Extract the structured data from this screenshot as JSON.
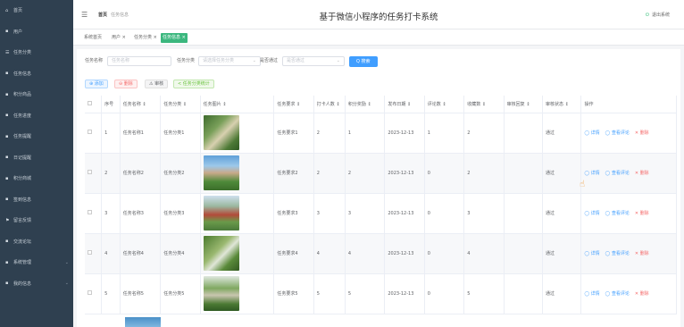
{
  "sidebar": {
    "items": [
      {
        "icon": "⌂",
        "label": "首页"
      },
      {
        "icon": "▪",
        "label": "用户"
      },
      {
        "icon": "☰",
        "label": "任务分类"
      },
      {
        "icon": "▪",
        "label": "任务信息"
      },
      {
        "icon": "▪",
        "label": "积分商品"
      },
      {
        "icon": "▪",
        "label": "任务进度"
      },
      {
        "icon": "▪",
        "label": "任务提醒"
      },
      {
        "icon": "▪",
        "label": "日记提醒"
      },
      {
        "icon": "▪",
        "label": "积分商城"
      },
      {
        "icon": "▪",
        "label": "签到信息"
      },
      {
        "icon": "⚑",
        "label": "留言反馈"
      },
      {
        "icon": "▪",
        "label": "交流论坛"
      },
      {
        "icon": "▪",
        "label": "系统管理",
        "arrow": "⌄"
      },
      {
        "icon": "▪",
        "label": "我的信息",
        "arrow": "⌄"
      }
    ]
  },
  "header": {
    "menu_icon": "☰",
    "crumb_home": "首页",
    "crumb_current": "任务信息",
    "title": "基于微信小程序的任务打卡系统",
    "logout": "退出系统",
    "logout_icon": "⏻"
  },
  "tabs": [
    "系统首页",
    "用户 ×",
    "任务分类 ×",
    "任务信息 ×"
  ],
  "filters": {
    "name_label": "任务名称",
    "name_placeholder": "任务名称",
    "category_label": "任务分类",
    "category_placeholder": "请选择任务分类",
    "audit_label": "是否通过",
    "audit_placeholder": "是否通过",
    "search_button": "Q 搜索"
  },
  "toolbar": {
    "add": "⊕ 添加",
    "delete": "⊖ 删除",
    "audit": "⚠ 审核",
    "stat": "< 任务分类统计"
  },
  "table": {
    "headers": [
      "",
      "序号",
      "任务名称 ↕",
      "任务分类 ↕",
      "任务图片 ↕",
      "任务要求 ↕",
      "打卡人数 ↕",
      "积分奖励 ↕",
      "发布日期 ↕",
      "评论数 ↕",
      "收藏数 ↕",
      "审核回复 ↕",
      "审核状态 ↕",
      "操作"
    ],
    "rows": [
      {
        "idx": "1",
        "name": "任务名称1",
        "cat": "任务分类1",
        "req": "任务要求1",
        "people": "2",
        "points": "1",
        "date": "2023-12-13",
        "comments": "1",
        "fav": "2",
        "reply": "",
        "status": "通过"
      },
      {
        "idx": "2",
        "name": "任务名称2",
        "cat": "任务分类2",
        "req": "任务要求2",
        "people": "2",
        "points": "2",
        "date": "2023-12-13",
        "comments": "0",
        "fav": "2",
        "reply": "",
        "status": "通过"
      },
      {
        "idx": "3",
        "name": "任务名称3",
        "cat": "任务分类3",
        "req": "任务要求3",
        "people": "3",
        "points": "3",
        "date": "2023-12-13",
        "comments": "0",
        "fav": "3",
        "reply": "",
        "status": "通过"
      },
      {
        "idx": "4",
        "name": "任务名称4",
        "cat": "任务分类4",
        "req": "任务要求4",
        "people": "4",
        "points": "4",
        "date": "2023-12-13",
        "comments": "0",
        "fav": "4",
        "reply": "",
        "status": "通过"
      },
      {
        "idx": "5",
        "name": "任务名称5",
        "cat": "任务分类5",
        "req": "任务要求5",
        "people": "5",
        "points": "5",
        "date": "2023-12-13",
        "comments": "0",
        "fav": "5",
        "reply": "",
        "status": "通过"
      }
    ],
    "ops": {
      "detail": "◯ 详情",
      "comments": "◯ 查看评论",
      "delete": "✕ 删除"
    }
  },
  "colors": {
    "sidebar": "#2f4050",
    "accent": "#3bb77e",
    "primary": "#409eff",
    "danger": "#f56c6c"
  }
}
